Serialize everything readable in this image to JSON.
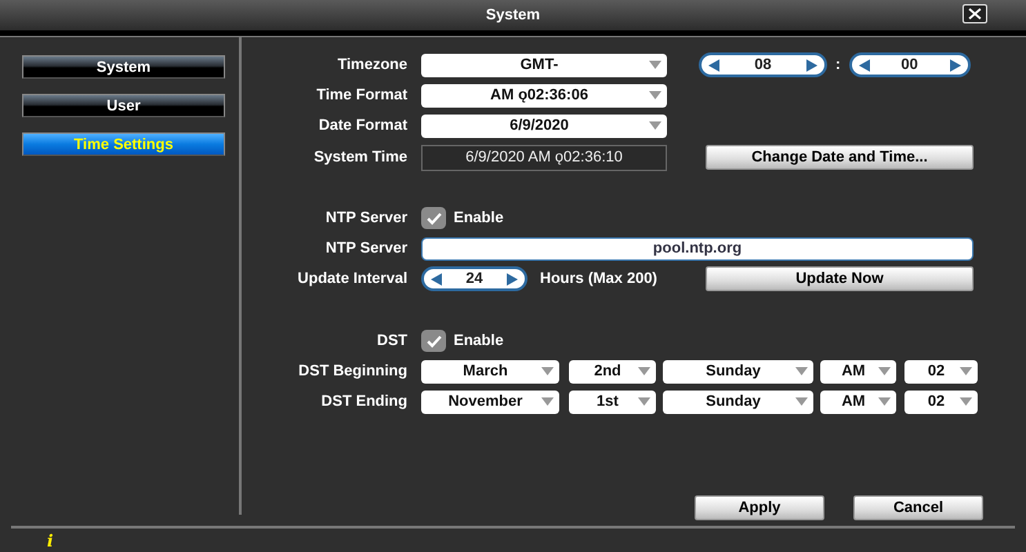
{
  "window": {
    "title": "System"
  },
  "sidebar": {
    "items": [
      {
        "label": "System",
        "selected": false
      },
      {
        "label": "User",
        "selected": false
      },
      {
        "label": "Time Settings",
        "selected": true
      }
    ]
  },
  "time": {
    "timezone": {
      "label": "Timezone",
      "value": "GMT-",
      "hour": "08",
      "separator": ":",
      "minute": "00"
    },
    "time_format": {
      "label": "Time Format",
      "value": "AM ǫ02:36:06"
    },
    "date_format": {
      "label": "Date Format",
      "value": "6/9/2020"
    },
    "system_time": {
      "label": "System Time",
      "value": "6/9/2020 AM ǫ02:36:10",
      "button": "Change Date and Time..."
    }
  },
  "ntp": {
    "enable": {
      "label": "NTP Server",
      "checked": true,
      "text": "Enable"
    },
    "server": {
      "label": "NTP Server",
      "value": "pool.ntp.org"
    },
    "interval": {
      "label": "Update Interval",
      "value": "24",
      "unit": "Hours (Max 200)",
      "button": "Update Now"
    }
  },
  "dst": {
    "enable": {
      "label": "DST",
      "checked": true,
      "text": "Enable"
    },
    "rows": [
      {
        "label": "DST Beginning",
        "month": "March",
        "week": "2nd",
        "day": "Sunday",
        "ampm": "AM",
        "hour": "02"
      },
      {
        "label": "DST Ending",
        "month": "November",
        "week": "1st",
        "day": "Sunday",
        "ampm": "AM",
        "hour": "02"
      }
    ]
  },
  "buttons": [
    "Apply",
    "Cancel"
  ],
  "status_bar": {
    "icon": "i"
  }
}
